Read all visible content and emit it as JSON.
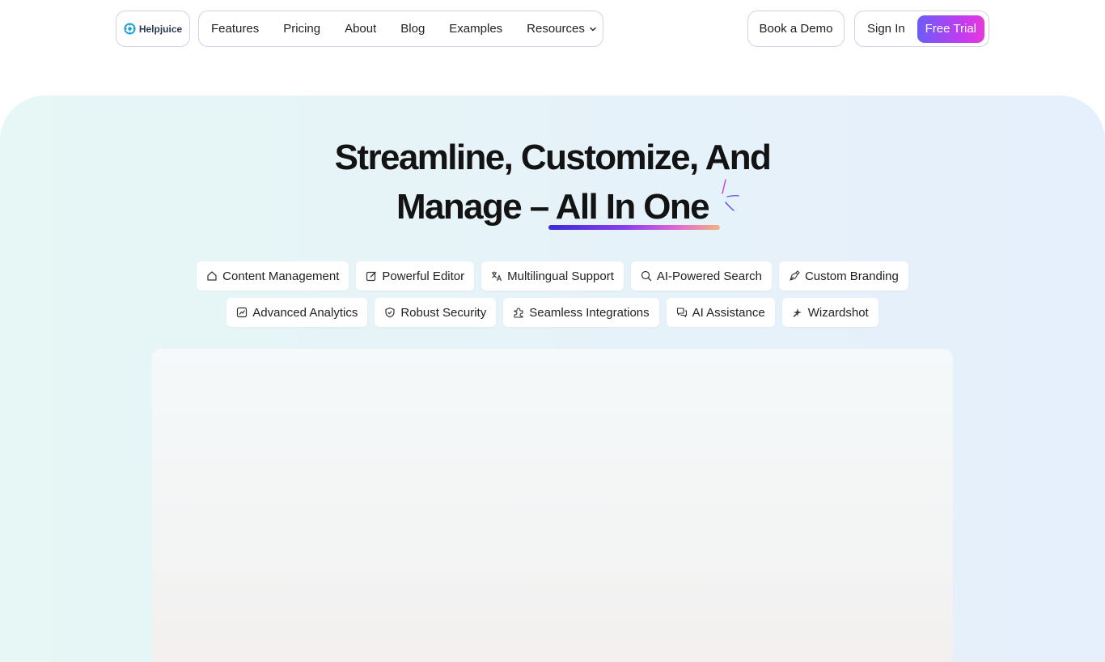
{
  "header": {
    "logo_text": "Helpjuice",
    "nav": [
      "Features",
      "Pricing",
      "About",
      "Blog",
      "Examples",
      "Resources"
    ],
    "book_demo": "Book a Demo",
    "sign_in": "Sign In",
    "free_trial": "Free Trial"
  },
  "hero": {
    "headline_line1": "Streamline, Customize, And",
    "headline_line2_prefix": "Manage – ",
    "headline_line2_highlight": "All In One",
    "features_row1": [
      {
        "label": "Content Management",
        "icon": "home-icon"
      },
      {
        "label": "Powerful Editor",
        "icon": "edit-icon"
      },
      {
        "label": "Multilingual Support",
        "icon": "translate-icon"
      },
      {
        "label": "AI-Powered Search",
        "icon": "search-icon"
      },
      {
        "label": "Custom Branding",
        "icon": "pen-tool-icon"
      }
    ],
    "features_row2": [
      {
        "label": "Advanced Analytics",
        "icon": "chart-icon"
      },
      {
        "label": "Robust Security",
        "icon": "shield-icon"
      },
      {
        "label": "Seamless Integrations",
        "icon": "puzzle-icon"
      },
      {
        "label": "AI Assistance",
        "icon": "chat-icon"
      },
      {
        "label": "Wizardshot",
        "icon": "sparkle-icon"
      }
    ]
  },
  "colors": {
    "accent_gradient_start": "#6b5cf6",
    "accent_gradient_end": "#e63ad8",
    "hero_bg": "#e6f3f8"
  }
}
